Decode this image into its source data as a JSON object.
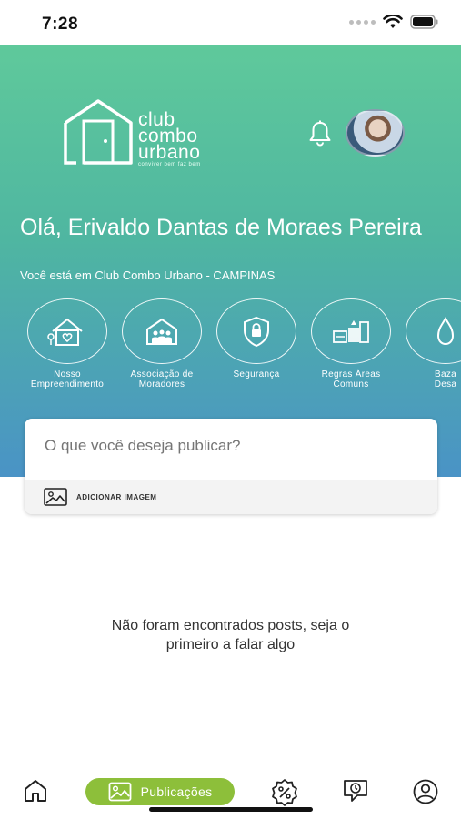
{
  "status_bar": {
    "time": "7:28"
  },
  "header": {
    "logo": {
      "line1": "club",
      "line2": "combo",
      "line3": "urbano",
      "tagline": "conviver bem faz bem"
    },
    "greeting": "Olá, Erivaldo Dantas de Moraes Pereira",
    "location": "Você está em Club Combo Urbano - CAMPINAS"
  },
  "shortcuts": [
    {
      "line1": "Nosso",
      "line2": "Empreendimento",
      "icon": "house-icon"
    },
    {
      "line1": "Associação de",
      "line2": "Moradores",
      "icon": "residents-icon"
    },
    {
      "line1": "Segurança",
      "line2": "",
      "icon": "shield-icon"
    },
    {
      "line1": "Regras Áreas",
      "line2": "Comuns",
      "icon": "rules-icon"
    },
    {
      "line1": "Baza",
      "line2": "Desa",
      "icon": "bazaar-icon"
    }
  ],
  "composer": {
    "placeholder": "O que você deseja publicar?",
    "add_image": "ADICIONAR IMAGEM"
  },
  "empty_state": {
    "line1": "Não foram encontrados posts, seja o",
    "line2": "primeiro a falar algo"
  },
  "tabbar": {
    "active_label": "Publicações"
  },
  "colors": {
    "gradient_top": "#5fc99b",
    "gradient_bottom": "#4a93c6",
    "tab_active": "#8dbf3a"
  }
}
